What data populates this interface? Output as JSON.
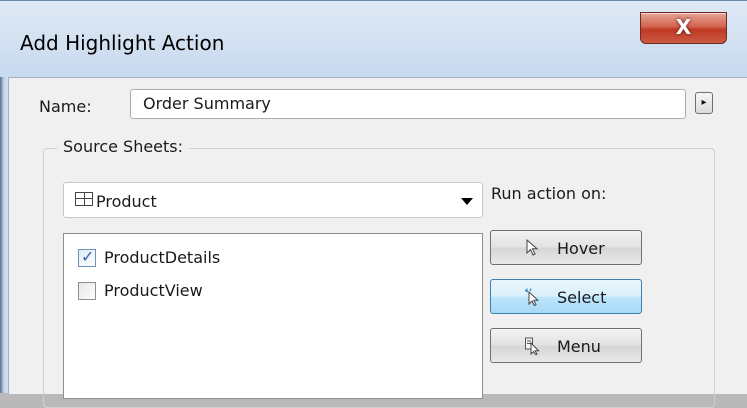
{
  "window": {
    "title": "Add Highlight Action",
    "close_glyph": "X"
  },
  "name_row": {
    "label": "Name:",
    "value": "Order Summary",
    "arrow_glyph": "▸"
  },
  "source_sheets": {
    "label": "Source Sheets:",
    "selected_sheet": "Product",
    "items": [
      {
        "label": "ProductDetails",
        "checked": true
      },
      {
        "label": "ProductView",
        "checked": false
      }
    ]
  },
  "run_action": {
    "label": "Run action on:",
    "options": [
      {
        "label": "Hover",
        "icon": "pointer-icon",
        "selected": false
      },
      {
        "label": "Select",
        "icon": "click-select-icon",
        "selected": true
      },
      {
        "label": "Menu",
        "icon": "menu-pointer-icon",
        "selected": false
      }
    ]
  },
  "colors": {
    "close_button": "#c7452f",
    "selected_button": "#bee6fd",
    "checkmark": "#3c5fa8"
  }
}
